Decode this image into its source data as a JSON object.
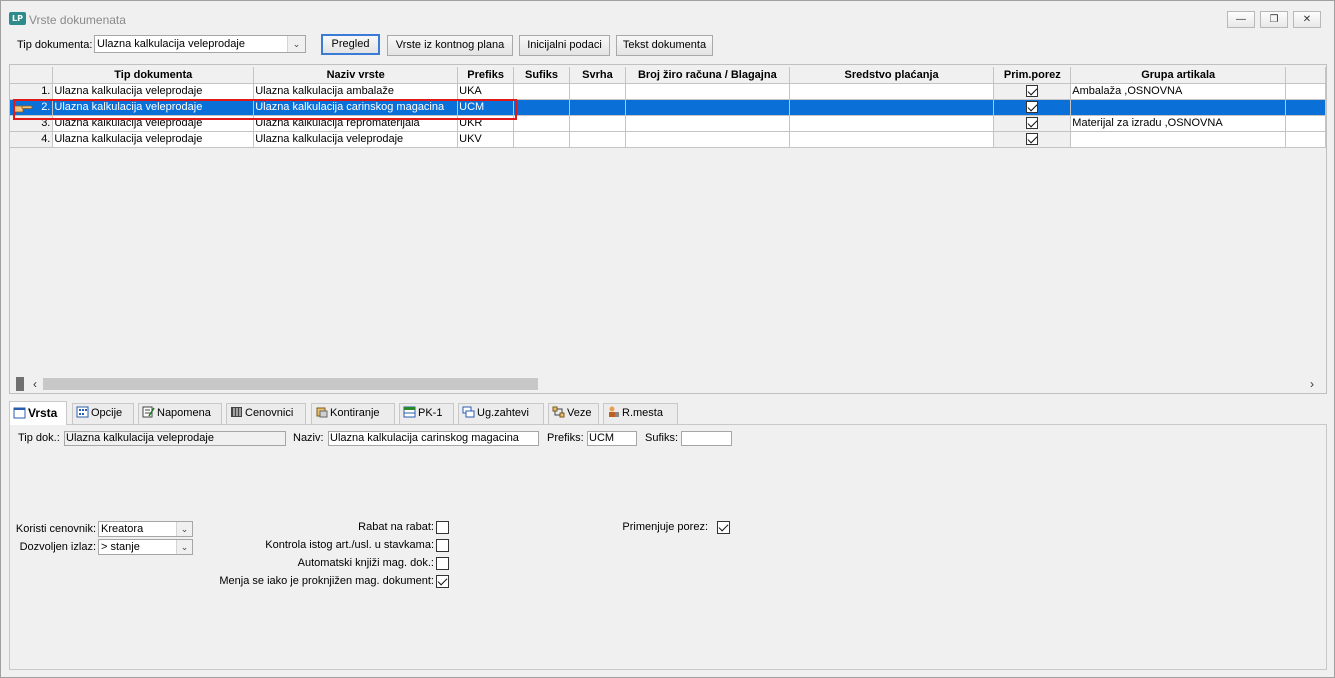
{
  "window": {
    "title": "Vrste dokumenata",
    "app_icon_text": "LP",
    "minimize": "—",
    "restore": "❐",
    "close": "✕"
  },
  "toolbar": {
    "tip_label": "Tip dokumenta:",
    "tip_value": "Ulazna kalkulacija veleprodaje",
    "pregled": "Pregled",
    "vrste_kontni": "Vrste iz kontnog plana",
    "inicijalni": "Inicijalni podaci",
    "tekst": "Tekst dokumenta"
  },
  "grid": {
    "columns": [
      "Tip dokumenta",
      "Naziv vrste",
      "Prefiks",
      "Sufiks",
      "Svrha",
      "Broj žiro računa / Blagajna",
      "Sredstvo plaćanja",
      "Prim.porez",
      "Grupa artikala"
    ],
    "rows": [
      {
        "num": "1.",
        "tip": "Ulazna kalkulacija veleprodaje",
        "naziv": "Ulazna kalkulacija ambalaže",
        "prefiks": "UKA",
        "sufiks": "",
        "svrha": "",
        "ziro": "",
        "sredstvo": "",
        "porez": true,
        "grupa": "Ambalaža ,OSNOVNA"
      },
      {
        "num": "2.",
        "tip": "Ulazna kalkulacija veleprodaje",
        "naziv": "Ulazna kalkulacija carinskog magacina",
        "prefiks": "UCM",
        "sufiks": "",
        "svrha": "",
        "ziro": "",
        "sredstvo": "",
        "porez": true,
        "grupa": ""
      },
      {
        "num": "3.",
        "tip": "Ulazna kalkulacija veleprodaje",
        "naziv": "Ulazna kalkulacija repromaterijala",
        "prefiks": "UKR",
        "sufiks": "",
        "svrha": "",
        "ziro": "",
        "sredstvo": "",
        "porez": true,
        "grupa": "Materijal za izradu ,OSNOVNA"
      },
      {
        "num": "4.",
        "tip": "Ulazna kalkulacija veleprodaje",
        "naziv": "Ulazna kalkulacija veleprodaje",
        "prefiks": "UKV",
        "sufiks": "",
        "svrha": "",
        "ziro": "",
        "sredstvo": "",
        "porez": true,
        "grupa": ""
      }
    ],
    "selected_row": 2
  },
  "tabs": [
    "Vrsta",
    "Opcije",
    "Napomena",
    "Cenovnici",
    "Kontiranje",
    "PK-1",
    "Ug.zahtevi",
    "Veze",
    "R.mesta"
  ],
  "detail": {
    "tip_dok_label": "Tip dok.:",
    "tip_dok_value": "Ulazna kalkulacija veleprodaje",
    "naziv_label": "Naziv:",
    "naziv_value": "Ulazna kalkulacija carinskog magacina",
    "prefiks_label": "Prefiks:",
    "prefiks_value": "UCM",
    "sufiks_label": "Sufiks:",
    "sufiks_value": "",
    "cenovnik_label": "Koristi cenovnik:",
    "cenovnik_value": "Kreatora",
    "izlaz_label": "Dozvoljen izlaz:",
    "izlaz_value": "> stanje",
    "rabat_label": "Rabat na rabat:",
    "rabat_checked": false,
    "kontrola_label": "Kontrola istog art./usl. u stavkama:",
    "kontrola_checked": false,
    "automatski_label": "Automatski knjiži mag. dok.:",
    "automatski_checked": false,
    "menja_label": "Menja se iako je proknjižen mag. dokument:",
    "menja_checked": true,
    "porez_label": "Primenjuje porez:",
    "porez_checked": true
  }
}
